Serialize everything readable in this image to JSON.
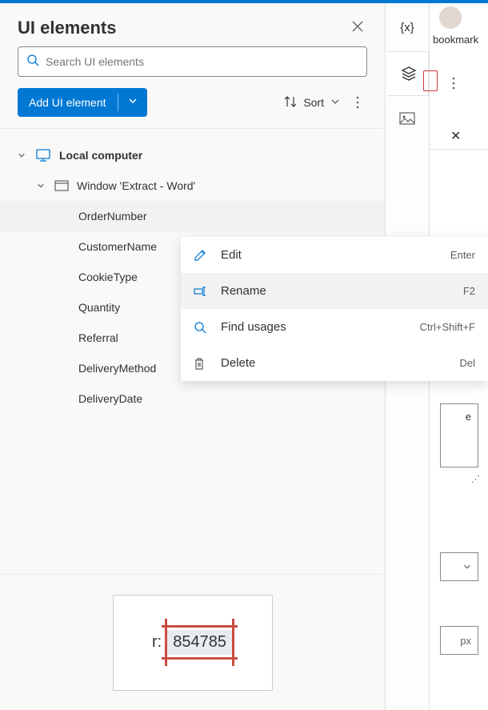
{
  "panel": {
    "title": "UI elements",
    "search_placeholder": "Search UI elements",
    "add_button": "Add UI element",
    "sort_label": "Sort"
  },
  "tree": {
    "root": "Local computer",
    "window": "Window 'Extract - Word'",
    "items": [
      "OrderNumber",
      "CustomerName",
      "CookieType",
      "Quantity",
      "Referral",
      "DeliveryMethod",
      "DeliveryDate"
    ]
  },
  "context_menu": [
    {
      "label": "Edit",
      "shortcut": "Enter",
      "icon": "pencil"
    },
    {
      "label": "Rename",
      "shortcut": "F2",
      "icon": "rename"
    },
    {
      "label": "Find usages",
      "shortcut": "Ctrl+Shift+F",
      "icon": "search"
    },
    {
      "label": "Delete",
      "shortcut": "Del",
      "icon": "trash"
    }
  ],
  "preview": {
    "prefix": "r:",
    "value": "854785"
  },
  "sidebar": {
    "variables_label": "{x}"
  },
  "far_right": {
    "bookmark": "bookmark",
    "px_label": "px",
    "letter": "e"
  }
}
